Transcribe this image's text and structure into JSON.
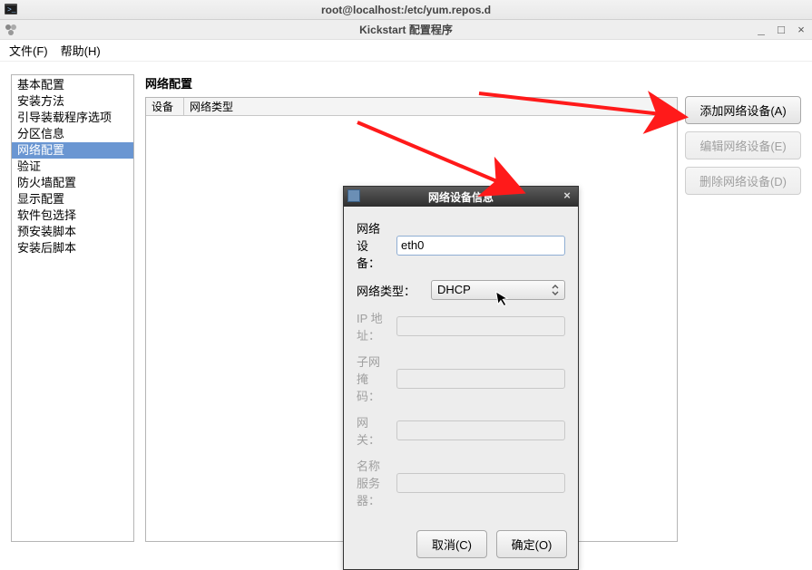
{
  "outer_window": {
    "title": "root@localhost:/etc/yum.repos.d"
  },
  "inner_window": {
    "title": "Kickstart 配置程序"
  },
  "menubar": {
    "file": "文件(F)",
    "help": "帮助(H)"
  },
  "sidebar": {
    "items": [
      {
        "label": "基本配置"
      },
      {
        "label": "安装方法"
      },
      {
        "label": "引导装载程序选项"
      },
      {
        "label": "分区信息"
      },
      {
        "label": "网络配置"
      },
      {
        "label": "验证"
      },
      {
        "label": "防火墙配置"
      },
      {
        "label": "显示配置"
      },
      {
        "label": "软件包选择"
      },
      {
        "label": "预安装脚本"
      },
      {
        "label": "安装后脚本"
      }
    ],
    "selected_index": 4
  },
  "panel": {
    "title": "网络配置",
    "columns": [
      "设备",
      "网络类型"
    ]
  },
  "buttons": {
    "add": "添加网络设备(A)",
    "edit": "编辑网络设备(E)",
    "delete": "删除网络设备(D)"
  },
  "dialog": {
    "title": "网络设备信息",
    "labels": {
      "device": "网络设备：",
      "type": "网络类型：",
      "ip": "IP 地址：",
      "netmask": "子网掩码：",
      "gateway": "网关：",
      "nameserver": "名称服务器："
    },
    "values": {
      "device": "eth0",
      "type": "DHCP",
      "ip": "",
      "netmask": "",
      "gateway": "",
      "nameserver": ""
    },
    "buttons": {
      "cancel": "取消(C)",
      "ok": "确定(O)"
    }
  }
}
